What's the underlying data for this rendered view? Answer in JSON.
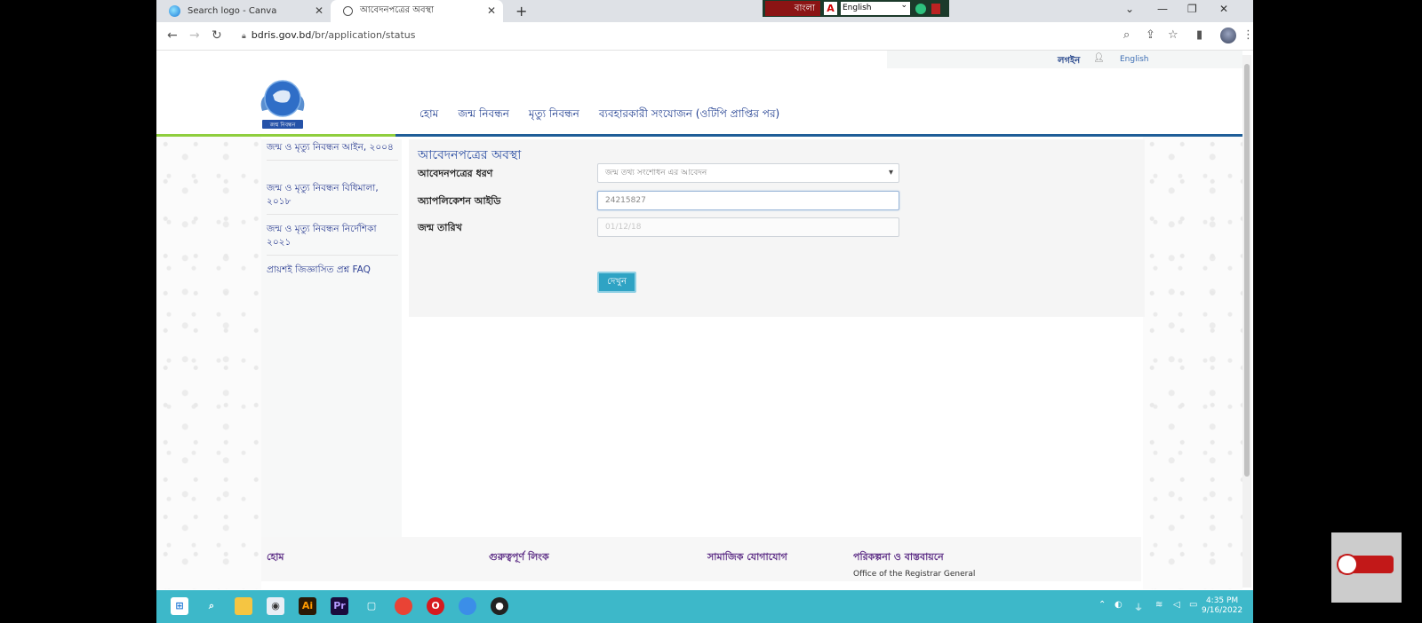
{
  "browser": {
    "tabs": [
      {
        "title": "Search logo - Canva"
      },
      {
        "title": "আবেদনপত্রের অবস্থা"
      }
    ],
    "new_tab": "+",
    "url_host": "bdris.gov.bd",
    "url_path": "/br/application/status",
    "ime": {
      "script_label": "বাংলা",
      "language": "English"
    }
  },
  "page": {
    "login": "লগইন",
    "language_link": "English",
    "logo_text": "জন্ম নিবন্ধন",
    "nav": [
      "হোম",
      "জন্ম নিবন্ধন",
      "মৃত্যু নিবন্ধন",
      "ব্যবহারকারী সংযোজন (ওটিপি প্রাপ্তির পর)"
    ],
    "sidebar": [
      "জন্ম ও মৃত্যু নিবন্ধন আইন, ২০০৪",
      "জন্ম ও মৃত্যু নিবন্ধন বিধিমালা, ২০১৮",
      "জন্ম ও মৃত্যু নিবন্ধন নির্দেশিকা ২০২১",
      "প্রায়শই জিজ্ঞাসিত প্রশ্ন FAQ"
    ],
    "form": {
      "title": "আবেদনপত্রের অবস্থা",
      "type_label": "আবেদনপত্রের ধরণ",
      "type_value": "জন্ম তথ্য সংশোধন এর আবেদন",
      "id_label": "অ্যাপলিকেশন আইডি",
      "id_value": "24215827",
      "date_label": "জন্ম তারিখ",
      "date_placeholder": "01/12/18",
      "search_button": "দেখুন"
    },
    "footer": {
      "home": "হোম",
      "important_links": "গুরুত্বপূর্ণ লিংক",
      "social": "সামাজিক যোগাযোগ",
      "planning": "পরিকল্পনা ও বাস্তবায়নে",
      "office": "Office of the Registrar General"
    }
  },
  "taskbar": {
    "time": "4:35 PM",
    "date": "9/16/2022"
  }
}
